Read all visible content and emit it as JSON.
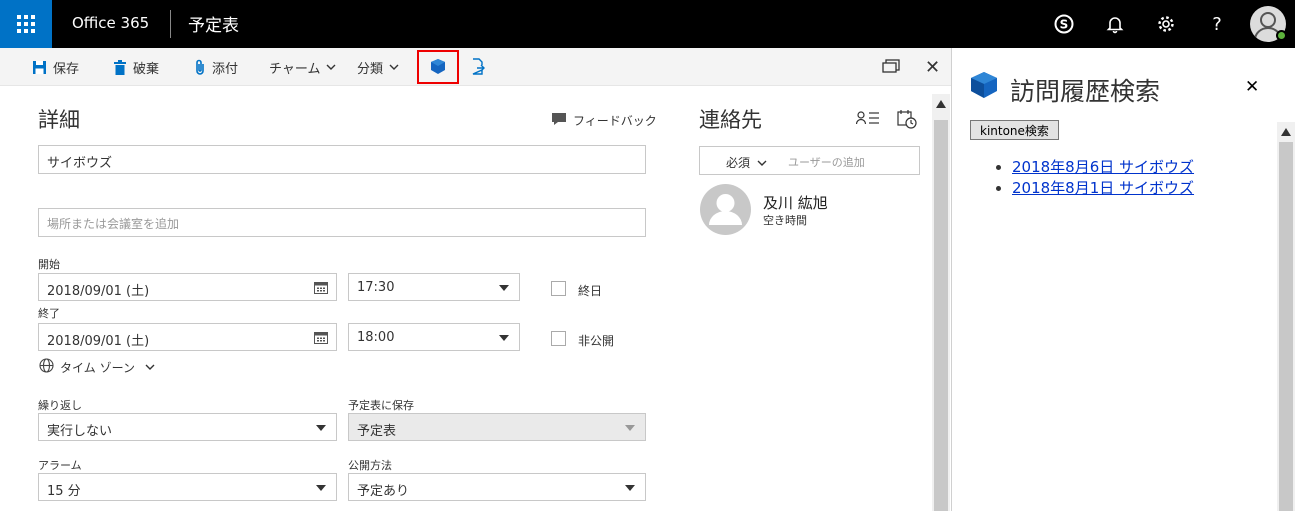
{
  "topbar": {
    "brand": "Office 365",
    "title": "予定表"
  },
  "toolbar": {
    "save": "保存",
    "discard": "破棄",
    "attach": "添付",
    "charm": "チャーム",
    "categorize": "分類"
  },
  "details": {
    "heading": "詳細",
    "feedback": "フィードバック",
    "subject_value": "サイボウズ",
    "location_placeholder": "場所または会議室を追加",
    "start_label": "開始",
    "start_date": "2018/09/01 (土)",
    "start_time": "17:30",
    "allday_label": "終日",
    "end_label": "終了",
    "end_date": "2018/09/01 (土)",
    "end_time": "18:00",
    "private_label": "非公開",
    "timezone": "タイム ゾーン",
    "repeat_label": "繰り返し",
    "repeat_value": "実行しない",
    "save_to_label": "予定表に保存",
    "save_to_value": "予定表",
    "alarm_label": "アラーム",
    "alarm_value": "15 分",
    "show_as_label": "公開方法",
    "show_as_value": "予定あり"
  },
  "contacts": {
    "heading": "連絡先",
    "required": "必須",
    "add_user_placeholder": "ユーザーの追加",
    "person_name": "及川 紘旭",
    "person_status": "空き時間"
  },
  "side_panel": {
    "title": "訪問履歴検索",
    "search_button": "kintone検索",
    "results": [
      "2018年8月6日 サイボウズ",
      "2018年8月1日 サイボウズ"
    ]
  },
  "colors": {
    "accent": "#0072c6",
    "kintone": "#1565c0",
    "highlight": "#ee0000"
  }
}
